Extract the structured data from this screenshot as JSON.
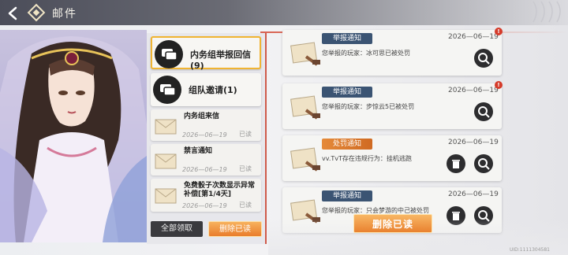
{
  "header": {
    "title": "邮件"
  },
  "categories": [
    {
      "label": "内务组举报回信(9)"
    },
    {
      "label": "组队邀请(1)"
    }
  ],
  "left_mails": [
    {
      "title": "内务组来信",
      "date": "2026—06—19",
      "status": "已读"
    },
    {
      "title": "禁言通知",
      "date": "2026—06—19",
      "status": "已读"
    },
    {
      "title": "免费骰子次数显示异常补偿[第1/4天]",
      "date": "2026—06—19",
      "status": "已读"
    }
  ],
  "left_actions": {
    "claim_all": "全部领取",
    "delete_read": "删除已读"
  },
  "messages": [
    {
      "tag": "举报通知",
      "date": "2026—06—19",
      "body": "您举报的玩家：冰可思已被处罚",
      "badge": "!"
    },
    {
      "tag": "举报通知",
      "date": "2026—06—19",
      "body": "您举报的玩家：步惊云5已被处罚",
      "badge": "!"
    },
    {
      "tag": "处罚通知",
      "date": "2026—06—19",
      "body": "vv.TvT存在违规行为：挂机逃跑"
    },
    {
      "tag": "举报通知",
      "date": "2026—06—19",
      "body": "您举报的玩家：只会梦游的中己被处罚"
    }
  ],
  "main_action": {
    "delete_read": "删除已读"
  },
  "footer": {
    "uid": "UID:1111304581"
  },
  "colors": {
    "accent_orange": "#e9812f",
    "tag_blue": "#3b5473",
    "red_line": "#cf5a4b"
  }
}
